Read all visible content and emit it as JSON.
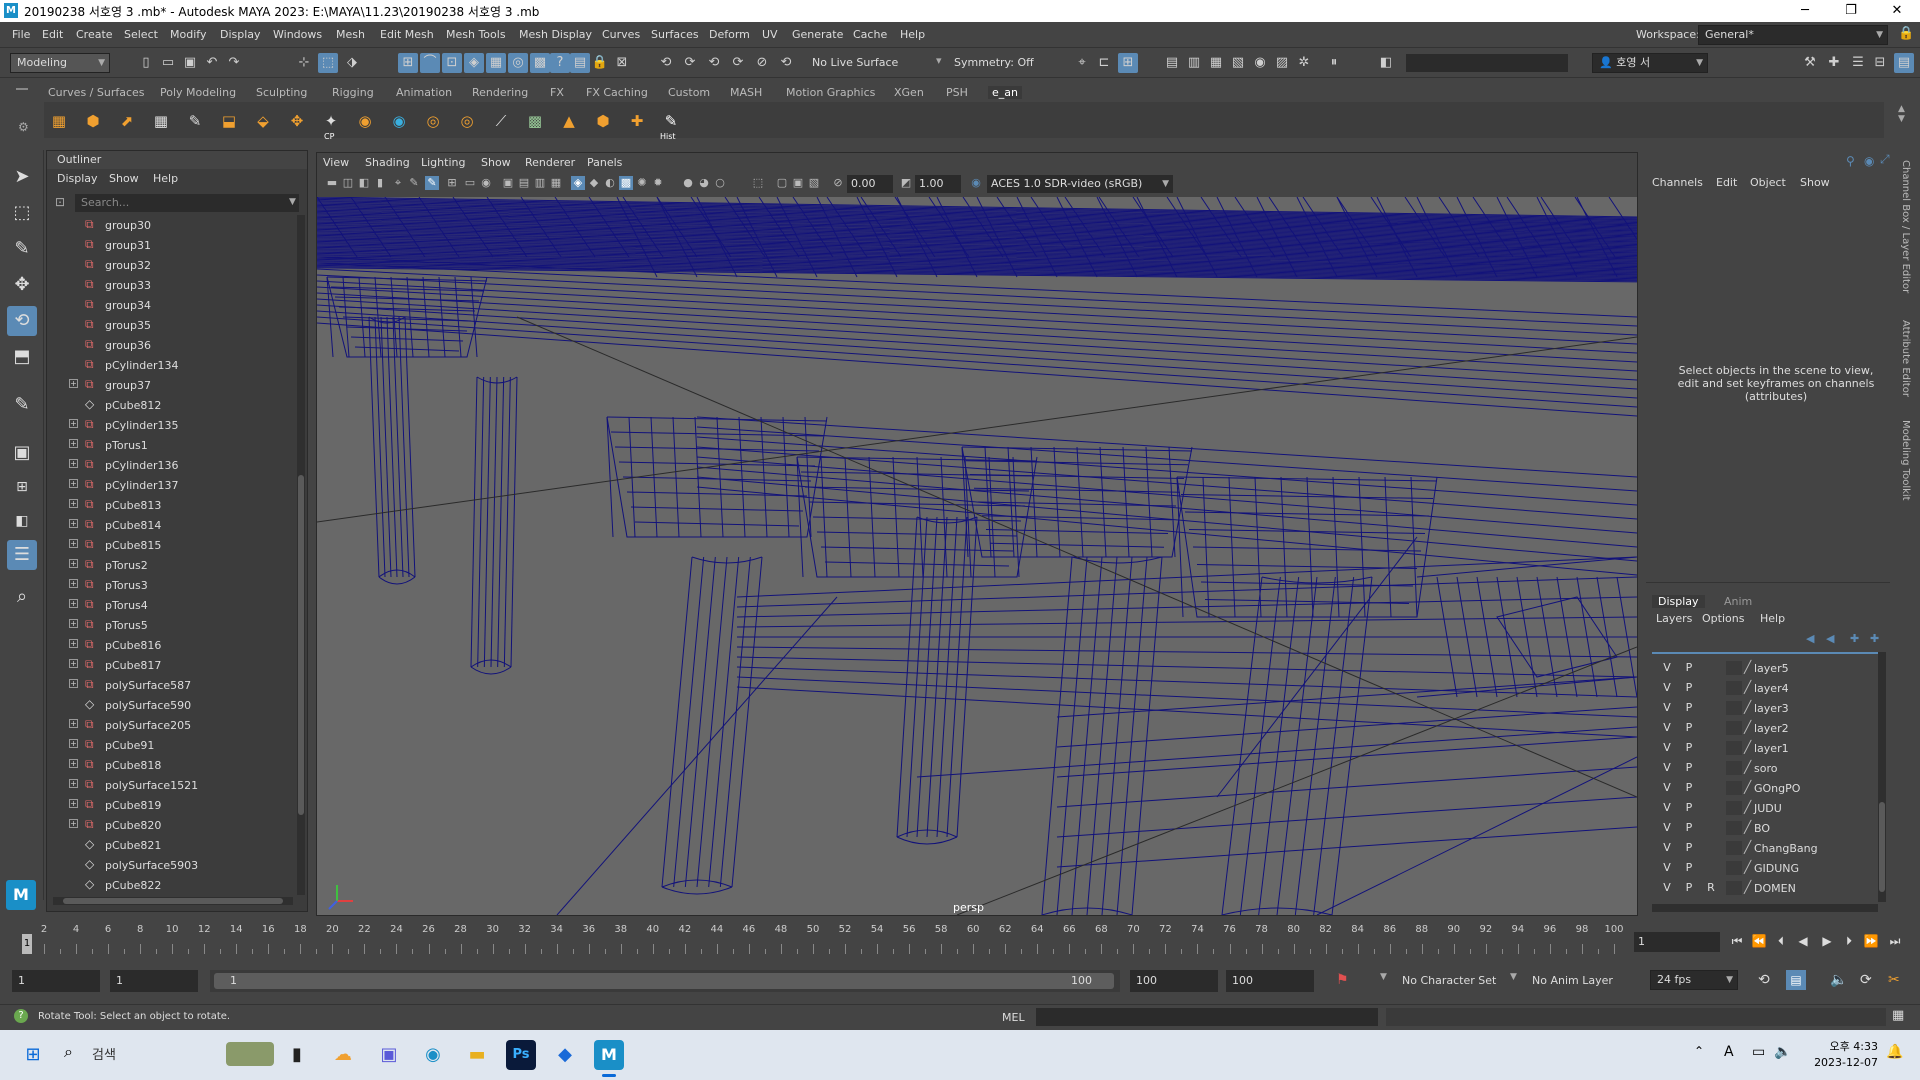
{
  "window": {
    "title": "20190238 서호영 3 .mb* - Autodesk MAYA 2023: E:\\MAYA\\11.23\\20190238 서호영 3 .mb",
    "minimize": "─",
    "maximize": "❐",
    "close": "✕"
  },
  "menubar": {
    "items": [
      "File",
      "Edit",
      "Create",
      "Select",
      "Modify",
      "Display",
      "Windows",
      "Mesh",
      "Edit Mesh",
      "Mesh Tools",
      "Mesh Display",
      "Curves",
      "Surfaces",
      "Deform",
      "UV",
      "Generate",
      "Cache",
      "Help"
    ],
    "workspace_label": "Workspace:",
    "workspace_value": "General*"
  },
  "statusline": {
    "mode": "Modeling",
    "live_surface": "No Live Surface",
    "symmetry": "Symmetry: Off",
    "user": "호영 서"
  },
  "shelf": {
    "tabs": [
      "Curves / Surfaces",
      "Poly Modeling",
      "Sculpting",
      "Rigging",
      "Animation",
      "Rendering",
      "FX",
      "FX Caching",
      "Custom",
      "MASH",
      "Motion Graphics",
      "XGen",
      "PSH",
      "e_an"
    ],
    "active_tab": "e_an",
    "label_cp": "CP",
    "label_hist": "Hist"
  },
  "outliner": {
    "title": "Outliner",
    "menu": [
      "Display",
      "Show",
      "Help"
    ],
    "search_placeholder": "Search...",
    "items": [
      {
        "name": "group30",
        "type": "group",
        "expand": false
      },
      {
        "name": "group31",
        "type": "group",
        "expand": false
      },
      {
        "name": "group32",
        "type": "group",
        "expand": false
      },
      {
        "name": "group33",
        "type": "group",
        "expand": false
      },
      {
        "name": "group34",
        "type": "group",
        "expand": false
      },
      {
        "name": "group35",
        "type": "group",
        "expand": false
      },
      {
        "name": "group36",
        "type": "group",
        "expand": false
      },
      {
        "name": "pCylinder134",
        "type": "group",
        "expand": false
      },
      {
        "name": "group37",
        "type": "group",
        "expand": true
      },
      {
        "name": "pCube812",
        "type": "mesh",
        "expand": false
      },
      {
        "name": "pCylinder135",
        "type": "group",
        "expand": true
      },
      {
        "name": "pTorus1",
        "type": "group",
        "expand": true
      },
      {
        "name": "pCylinder136",
        "type": "group",
        "expand": true
      },
      {
        "name": "pCylinder137",
        "type": "group",
        "expand": true
      },
      {
        "name": "pCube813",
        "type": "group",
        "expand": true
      },
      {
        "name": "pCube814",
        "type": "group",
        "expand": true
      },
      {
        "name": "pCube815",
        "type": "group",
        "expand": true
      },
      {
        "name": "pTorus2",
        "type": "group",
        "expand": true
      },
      {
        "name": "pTorus3",
        "type": "group",
        "expand": true
      },
      {
        "name": "pTorus4",
        "type": "group",
        "expand": true
      },
      {
        "name": "pTorus5",
        "type": "group",
        "expand": true
      },
      {
        "name": "pCube816",
        "type": "group",
        "expand": true
      },
      {
        "name": "pCube817",
        "type": "group",
        "expand": true
      },
      {
        "name": "polySurface587",
        "type": "group",
        "expand": true
      },
      {
        "name": "polySurface590",
        "type": "mesh",
        "expand": false
      },
      {
        "name": "polySurface205",
        "type": "group",
        "expand": true
      },
      {
        "name": "pCube91",
        "type": "group",
        "expand": true
      },
      {
        "name": "pCube818",
        "type": "group",
        "expand": true
      },
      {
        "name": "polySurface1521",
        "type": "group",
        "expand": true
      },
      {
        "name": "pCube819",
        "type": "group",
        "expand": true
      },
      {
        "name": "pCube820",
        "type": "group",
        "expand": true
      },
      {
        "name": "pCube821",
        "type": "mesh",
        "expand": false
      },
      {
        "name": "polySurface5903",
        "type": "mesh",
        "expand": false
      },
      {
        "name": "pCube822",
        "type": "mesh",
        "expand": false
      }
    ]
  },
  "viewport": {
    "menu": [
      "View",
      "Shading",
      "Lighting",
      "Show",
      "Renderer",
      "Panels"
    ],
    "field1": "0.00",
    "field2": "1.00",
    "colorspace": "ACES 1.0 SDR-video (sRGB)",
    "camera_label": "persp"
  },
  "channelbox": {
    "menu": [
      "Channels",
      "Edit",
      "Object",
      "Show"
    ],
    "message": "Select objects in the scene to view, edit and set keyframes on channels (attributes)",
    "layer_tabs": [
      "Display",
      "Anim"
    ],
    "layer_menu": [
      "Layers",
      "Options",
      "Help"
    ],
    "layers": [
      {
        "v": "V",
        "p": "P",
        "r": "",
        "name": "layer5"
      },
      {
        "v": "V",
        "p": "P",
        "r": "",
        "name": "layer4"
      },
      {
        "v": "V",
        "p": "P",
        "r": "",
        "name": "layer3"
      },
      {
        "v": "V",
        "p": "P",
        "r": "",
        "name": "layer2"
      },
      {
        "v": "V",
        "p": "P",
        "r": "",
        "name": "layer1"
      },
      {
        "v": "V",
        "p": "P",
        "r": "",
        "name": "soro"
      },
      {
        "v": "V",
        "p": "P",
        "r": "",
        "name": "GOngPO"
      },
      {
        "v": "V",
        "p": "P",
        "r": "",
        "name": "JUDU"
      },
      {
        "v": "V",
        "p": "P",
        "r": "",
        "name": "BO"
      },
      {
        "v": "V",
        "p": "P",
        "r": "",
        "name": "ChangBang"
      },
      {
        "v": "V",
        "p": "P",
        "r": "",
        "name": "GIDUNG"
      },
      {
        "v": "V",
        "p": "P",
        "r": "R",
        "name": "DOMEN"
      }
    ],
    "side_tabs": [
      "Channel Box / Layer Editor",
      "Attribute Editor",
      "Modeling Toolkit"
    ]
  },
  "timeline": {
    "ticks": [
      "2",
      "4",
      "6",
      "8",
      "10",
      "12",
      "14",
      "16",
      "18",
      "20",
      "22",
      "24",
      "26",
      "28",
      "30",
      "32",
      "34",
      "36",
      "38",
      "40",
      "42",
      "44",
      "46",
      "48",
      "50",
      "52",
      "54",
      "56",
      "58",
      "60",
      "62",
      "64",
      "66",
      "68",
      "70",
      "72",
      "74",
      "76",
      "78",
      "80",
      "82",
      "84",
      "86",
      "88",
      "90",
      "92",
      "94",
      "96",
      "98",
      "100"
    ],
    "current_frame_marker": "1",
    "current_frame_field": "1"
  },
  "range": {
    "start": "1",
    "playback_start": "1",
    "slider_left": "1",
    "slider_right": "100",
    "playback_end": "100",
    "end": "100",
    "character_set": "No Character Set",
    "anim_layer": "No Anim Layer",
    "fps": "24 fps"
  },
  "helpline": {
    "message": "Rotate Tool: Select an object to rotate.",
    "cmd_label": "MEL"
  },
  "taskbar": {
    "search": "검색",
    "time": "오후 4:33",
    "date": "2023-12-07",
    "ime": "A"
  },
  "colors": {
    "wire": "#12127a",
    "selection_blue": "#5b8ab5",
    "group_icon": "#e06a6a"
  }
}
